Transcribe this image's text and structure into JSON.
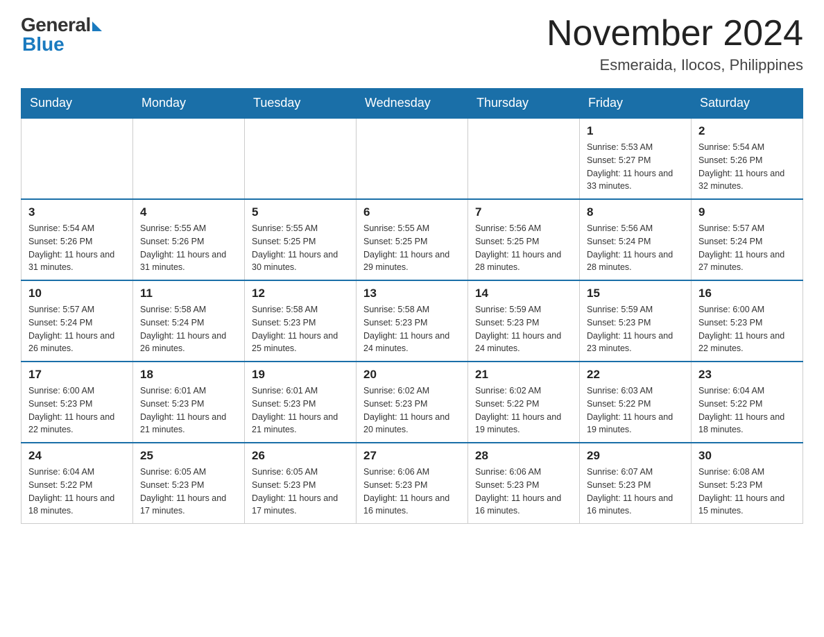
{
  "header": {
    "title": "November 2024",
    "location": "Esmeraida, Ilocos, Philippines",
    "logo_general": "General",
    "logo_blue": "Blue"
  },
  "weekdays": [
    "Sunday",
    "Monday",
    "Tuesday",
    "Wednesday",
    "Thursday",
    "Friday",
    "Saturday"
  ],
  "weeks": [
    {
      "days": [
        {
          "num": "",
          "info": "",
          "empty": true
        },
        {
          "num": "",
          "info": "",
          "empty": true
        },
        {
          "num": "",
          "info": "",
          "empty": true
        },
        {
          "num": "",
          "info": "",
          "empty": true
        },
        {
          "num": "",
          "info": "",
          "empty": true
        },
        {
          "num": "1",
          "info": "Sunrise: 5:53 AM\nSunset: 5:27 PM\nDaylight: 11 hours and 33 minutes."
        },
        {
          "num": "2",
          "info": "Sunrise: 5:54 AM\nSunset: 5:26 PM\nDaylight: 11 hours and 32 minutes."
        }
      ]
    },
    {
      "days": [
        {
          "num": "3",
          "info": "Sunrise: 5:54 AM\nSunset: 5:26 PM\nDaylight: 11 hours and 31 minutes."
        },
        {
          "num": "4",
          "info": "Sunrise: 5:55 AM\nSunset: 5:26 PM\nDaylight: 11 hours and 31 minutes."
        },
        {
          "num": "5",
          "info": "Sunrise: 5:55 AM\nSunset: 5:25 PM\nDaylight: 11 hours and 30 minutes."
        },
        {
          "num": "6",
          "info": "Sunrise: 5:55 AM\nSunset: 5:25 PM\nDaylight: 11 hours and 29 minutes."
        },
        {
          "num": "7",
          "info": "Sunrise: 5:56 AM\nSunset: 5:25 PM\nDaylight: 11 hours and 28 minutes."
        },
        {
          "num": "8",
          "info": "Sunrise: 5:56 AM\nSunset: 5:24 PM\nDaylight: 11 hours and 28 minutes."
        },
        {
          "num": "9",
          "info": "Sunrise: 5:57 AM\nSunset: 5:24 PM\nDaylight: 11 hours and 27 minutes."
        }
      ]
    },
    {
      "days": [
        {
          "num": "10",
          "info": "Sunrise: 5:57 AM\nSunset: 5:24 PM\nDaylight: 11 hours and 26 minutes."
        },
        {
          "num": "11",
          "info": "Sunrise: 5:58 AM\nSunset: 5:24 PM\nDaylight: 11 hours and 26 minutes."
        },
        {
          "num": "12",
          "info": "Sunrise: 5:58 AM\nSunset: 5:23 PM\nDaylight: 11 hours and 25 minutes."
        },
        {
          "num": "13",
          "info": "Sunrise: 5:58 AM\nSunset: 5:23 PM\nDaylight: 11 hours and 24 minutes."
        },
        {
          "num": "14",
          "info": "Sunrise: 5:59 AM\nSunset: 5:23 PM\nDaylight: 11 hours and 24 minutes."
        },
        {
          "num": "15",
          "info": "Sunrise: 5:59 AM\nSunset: 5:23 PM\nDaylight: 11 hours and 23 minutes."
        },
        {
          "num": "16",
          "info": "Sunrise: 6:00 AM\nSunset: 5:23 PM\nDaylight: 11 hours and 22 minutes."
        }
      ]
    },
    {
      "days": [
        {
          "num": "17",
          "info": "Sunrise: 6:00 AM\nSunset: 5:23 PM\nDaylight: 11 hours and 22 minutes."
        },
        {
          "num": "18",
          "info": "Sunrise: 6:01 AM\nSunset: 5:23 PM\nDaylight: 11 hours and 21 minutes."
        },
        {
          "num": "19",
          "info": "Sunrise: 6:01 AM\nSunset: 5:23 PM\nDaylight: 11 hours and 21 minutes."
        },
        {
          "num": "20",
          "info": "Sunrise: 6:02 AM\nSunset: 5:23 PM\nDaylight: 11 hours and 20 minutes."
        },
        {
          "num": "21",
          "info": "Sunrise: 6:02 AM\nSunset: 5:22 PM\nDaylight: 11 hours and 19 minutes."
        },
        {
          "num": "22",
          "info": "Sunrise: 6:03 AM\nSunset: 5:22 PM\nDaylight: 11 hours and 19 minutes."
        },
        {
          "num": "23",
          "info": "Sunrise: 6:04 AM\nSunset: 5:22 PM\nDaylight: 11 hours and 18 minutes."
        }
      ]
    },
    {
      "days": [
        {
          "num": "24",
          "info": "Sunrise: 6:04 AM\nSunset: 5:22 PM\nDaylight: 11 hours and 18 minutes."
        },
        {
          "num": "25",
          "info": "Sunrise: 6:05 AM\nSunset: 5:23 PM\nDaylight: 11 hours and 17 minutes."
        },
        {
          "num": "26",
          "info": "Sunrise: 6:05 AM\nSunset: 5:23 PM\nDaylight: 11 hours and 17 minutes."
        },
        {
          "num": "27",
          "info": "Sunrise: 6:06 AM\nSunset: 5:23 PM\nDaylight: 11 hours and 16 minutes."
        },
        {
          "num": "28",
          "info": "Sunrise: 6:06 AM\nSunset: 5:23 PM\nDaylight: 11 hours and 16 minutes."
        },
        {
          "num": "29",
          "info": "Sunrise: 6:07 AM\nSunset: 5:23 PM\nDaylight: 11 hours and 16 minutes."
        },
        {
          "num": "30",
          "info": "Sunrise: 6:08 AM\nSunset: 5:23 PM\nDaylight: 11 hours and 15 minutes."
        }
      ]
    }
  ]
}
